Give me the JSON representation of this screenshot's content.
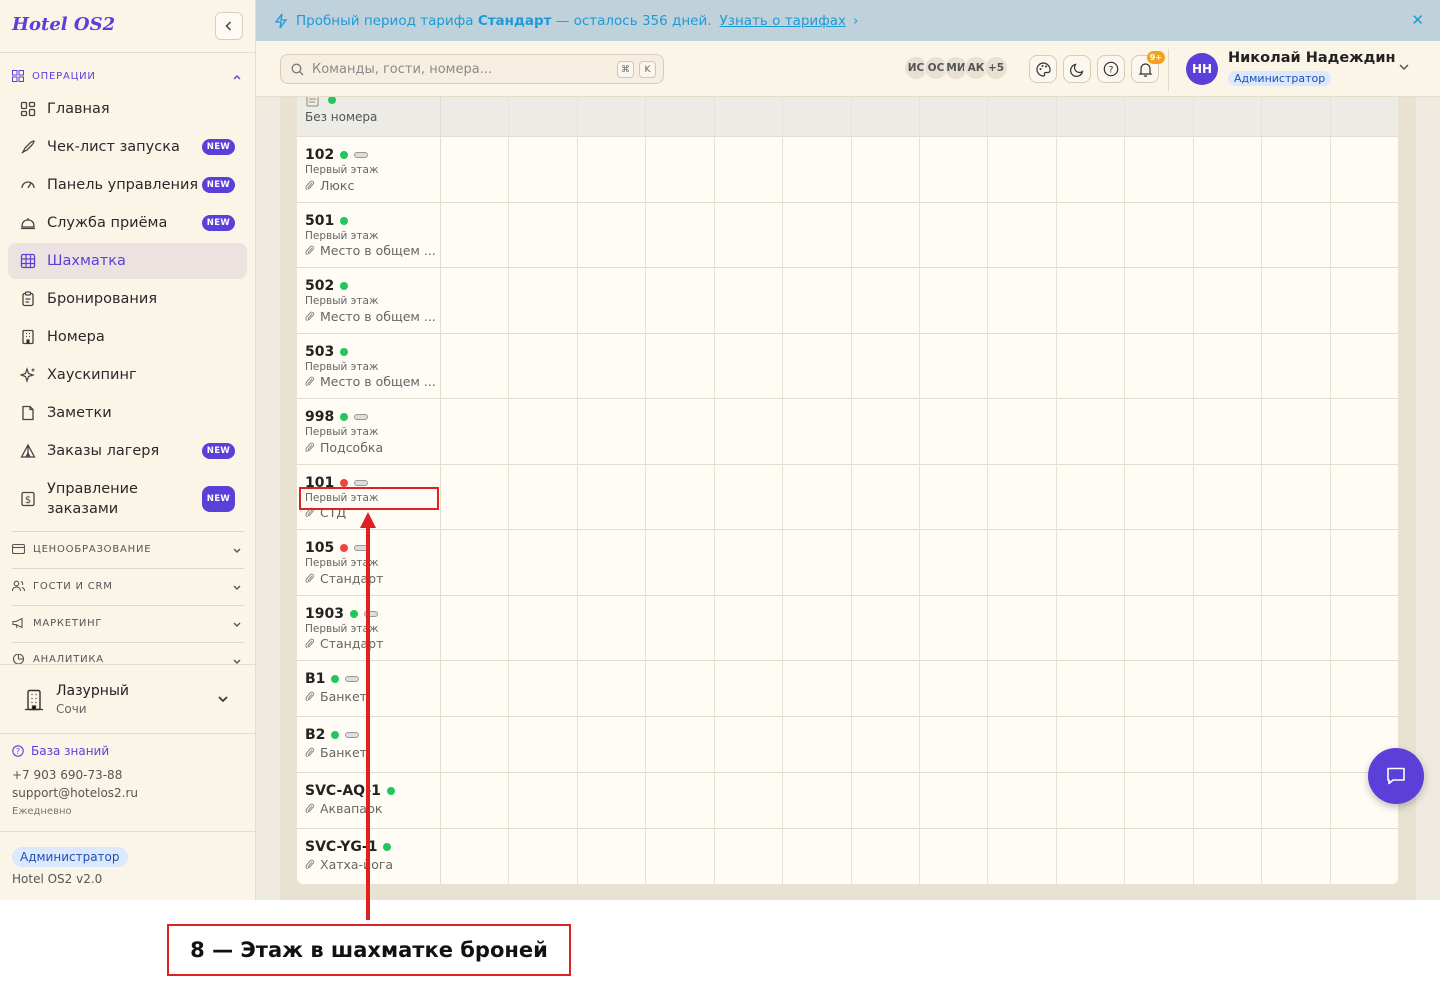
{
  "app": {
    "logo": "Hotel OS2"
  },
  "banner": {
    "prefix": "Пробный период тарифа",
    "plan": "Стандарт",
    "suffix": "— осталось 356 дней.",
    "link": "Узнать о тарифах",
    "link_arrow": "›",
    "close": "✕"
  },
  "search": {
    "placeholder": "Команды, гости, номера...",
    "key1": "⌘",
    "key2": "K"
  },
  "presence": {
    "avatars": [
      "ИС",
      "ОС",
      "МИ",
      "АК"
    ],
    "more": "+5"
  },
  "notifications": {
    "count": "9+"
  },
  "user": {
    "initials": "НН",
    "name": "Николай Надеждин",
    "role": "Администратор"
  },
  "sidebar": {
    "section_operations": "ОПЕРАЦИИ",
    "items": [
      {
        "label": "Главная",
        "icon": "dashboard-icon"
      },
      {
        "label": "Чек-лист запуска",
        "icon": "rocket-icon",
        "badge": "NEW"
      },
      {
        "label": "Панель управления",
        "icon": "gauge-icon",
        "badge": "NEW"
      },
      {
        "label": "Служба приёма",
        "icon": "bell-desk-icon",
        "badge": "NEW"
      },
      {
        "label": "Шахматка",
        "icon": "grid-icon"
      },
      {
        "label": "Бронирования",
        "icon": "clipboard-icon"
      },
      {
        "label": "Номера",
        "icon": "building-icon"
      },
      {
        "label": "Хаускипинг",
        "icon": "sparkles-icon"
      },
      {
        "label": "Заметки",
        "icon": "note-icon"
      },
      {
        "label": "Заказы лагеря",
        "icon": "tent-icon",
        "badge": "NEW"
      },
      {
        "label": "Управление заказами",
        "label_line1": "Управление",
        "label_line2": "заказами",
        "icon": "dollar-icon",
        "badge": "NEW"
      }
    ],
    "sections": [
      "ЦЕНООБРАЗОВАНИЕ",
      "ГОСТИ И CRM",
      "МАРКЕТИНГ",
      "АНАЛИТИКА"
    ],
    "hotel": {
      "name": "Лазурный",
      "city": "Сочи"
    },
    "footer": {
      "kb": "База знаний",
      "phone": "+7 903 690-73-88",
      "email": "support@hotelos2.ru",
      "hours": "Ежедневно",
      "role": "Администратор",
      "version": "Hotel OS2 v2.0"
    }
  },
  "grid": {
    "unassigned": "Без номера",
    "rows": [
      {
        "room": "102",
        "status": "green",
        "floor": "Первый этаж",
        "type": "Люкс"
      },
      {
        "room": "501",
        "status": "green",
        "floor": "Первый этаж",
        "type": "Место в общем ..."
      },
      {
        "room": "502",
        "status": "green",
        "floor": "Первый этаж",
        "type": "Место в общем ..."
      },
      {
        "room": "503",
        "status": "green",
        "floor": "Первый этаж",
        "type": "Место в общем ..."
      },
      {
        "room": "998",
        "status": "green",
        "floor": "Первый этаж",
        "type": "Подсобка"
      },
      {
        "room": "101",
        "status": "red",
        "floor": "Первый этаж",
        "type": "СТД"
      },
      {
        "room": "105",
        "status": "red",
        "floor": "Первый этаж",
        "type": "Стандарт"
      },
      {
        "room": "1903",
        "status": "green",
        "floor": "Первый этаж",
        "type": "Стандарт"
      },
      {
        "room": "B1",
        "status": "green",
        "floor": "",
        "type": "Банкет"
      },
      {
        "room": "B2",
        "status": "green",
        "floor": "",
        "type": "Банкет"
      },
      {
        "room": "SVC-AQ-1",
        "status": "green",
        "floor": "",
        "type": "Аквапарк"
      },
      {
        "room": "SVC-YG-1",
        "status": "green",
        "floor": "",
        "type": "Хатха-йога"
      }
    ]
  },
  "annotation": {
    "label": "8 — Этаж в шахматке броней"
  },
  "colors": {
    "accent": "#5b3fd9",
    "status_green": "#22c55e",
    "status_red": "#ef4444",
    "annotation": "#dd2222"
  }
}
